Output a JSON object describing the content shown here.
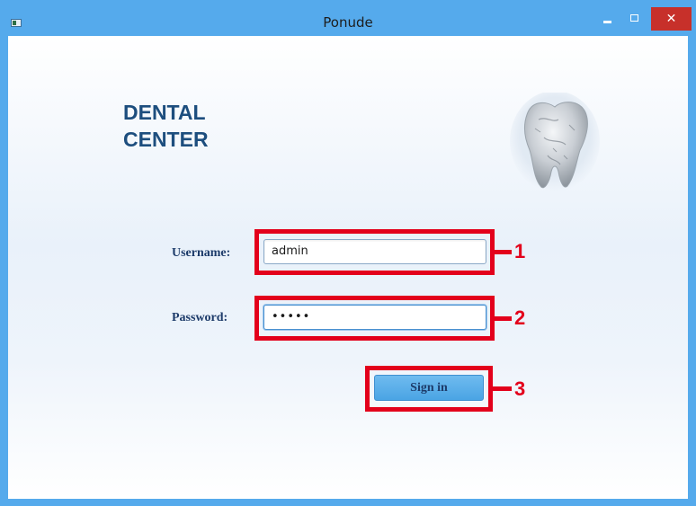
{
  "window": {
    "title": "Ponude",
    "close_glyph": "✕"
  },
  "brand": {
    "line1": "DENTAL",
    "line2": "CENTER",
    "logo_icon": "tooth-icon"
  },
  "form": {
    "username_label": "Username:",
    "username_value": "admin",
    "password_label": "Password:",
    "password_value": "•••••",
    "signin_label": "Sign in"
  },
  "annotations": [
    {
      "number": "1"
    },
    {
      "number": "2"
    },
    {
      "number": "3"
    }
  ],
  "colors": {
    "title_bar": "#55aaec",
    "close_button": "#c7302a",
    "brand_text": "#1d4e7e",
    "label_text": "#1d3b6a",
    "signin_button": "#4aa4e4",
    "highlight": "#e3001b"
  }
}
